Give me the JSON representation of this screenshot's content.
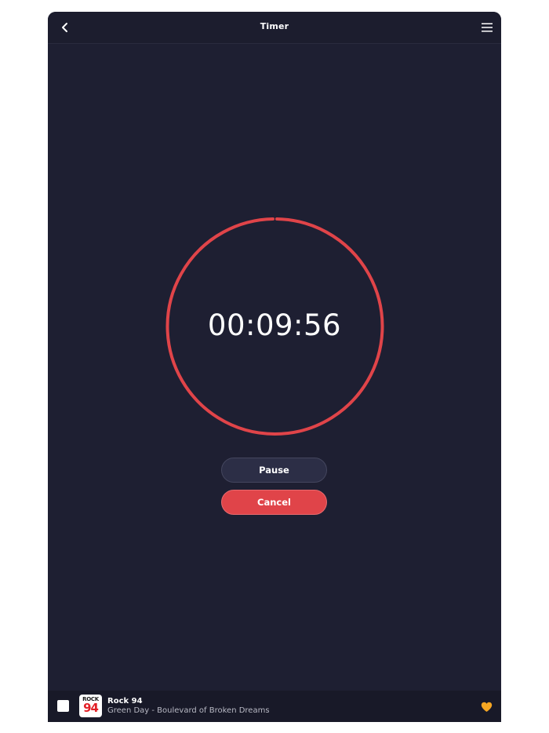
{
  "header": {
    "title": "Timer",
    "back_icon": "chevron-left-icon",
    "menu_icon": "hamburger-menu-icon"
  },
  "timer": {
    "display": "00:09:56",
    "ring_color": "#e04449"
  },
  "buttons": {
    "pause_label": "Pause",
    "cancel_label": "Cancel"
  },
  "player": {
    "stop_icon": "stop-icon",
    "logo_top": "ROCK",
    "logo_number": "94",
    "station_name": "Rock 94",
    "now_playing": "Green Day - Boulevard of Broken Dreams",
    "favorite_icon": "heart-icon",
    "favorite_color": "#f5a623"
  },
  "colors": {
    "background": "#1e1f32",
    "accent": "#e04449"
  }
}
